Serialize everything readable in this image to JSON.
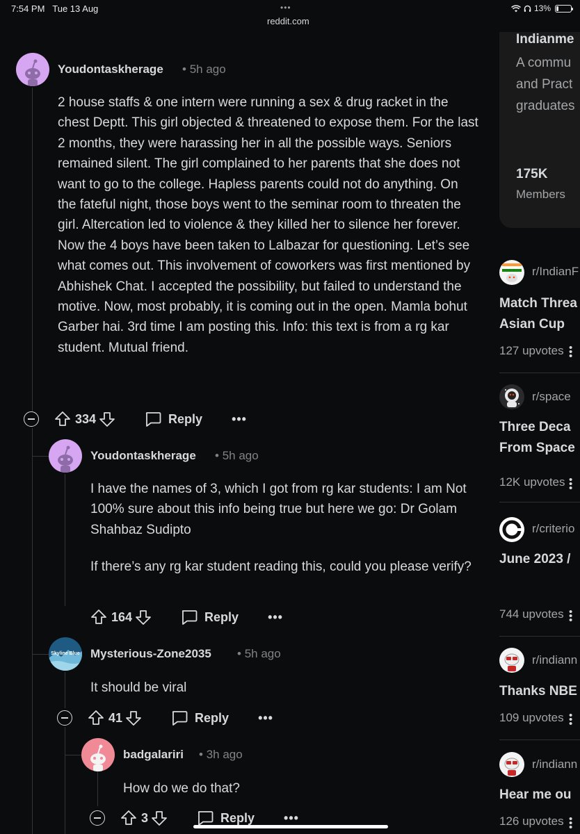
{
  "status_bar": {
    "time": "7:54 PM",
    "date": "Tue 13 Aug",
    "url": "reddit.com",
    "battery": "13%",
    "battery_level": 0.13
  },
  "comments": [
    {
      "author": "Youdontaskherage",
      "time": "5h ago",
      "body": "2 house staffs & one intern were running a sex & drug racket in the chest Deptt. This girl objected & threatened to expose them. For the last 2 months, they were harassing her in all the possible ways. Seniors remained silent. The girl complained to her parents that she does not want to go to the college. Hapless parents could not do anything. On the fateful night, those boys went to the seminar room to threaten the girl. Altercation led to violence & they killed her to silence her forever. Now the 4 boys have been taken to Lalbazar for questioning. Let’s see what comes out. This involvement of coworkers was first mentioned by Abhishek Chat. I accepted the possibility, but failed to understand the motive. Now, most probably, it is coming out in the open. Mamla bohut Garber hai. 3rd time I am posting this. Info: this text is from a rg kar student. Mutual friend.",
      "votes": "334",
      "reply_label": "Reply",
      "more_label": "•••"
    },
    {
      "author": "Youdontaskherage",
      "time": "5h ago",
      "body_p1": "I have the names of 3, which I got from rg kar students: I am Not 100% sure about this info being true but here we go: Dr Golam Shahbaz Sudipto",
      "body_p2": "If there’s any rg kar student reading this, could you please verify?",
      "votes": "164",
      "reply_label": "Reply",
      "more_label": "•••"
    },
    {
      "author": "Mysterious-Zone2035",
      "time": "5h ago",
      "avatar_text": "Skyline Blue",
      "body": "It should be viral",
      "votes": "41",
      "reply_label": "Reply",
      "more_label": "•••"
    },
    {
      "author": "badgalariri",
      "time": "3h ago",
      "body": "How do we do that?",
      "votes": "3",
      "reply_label": "Reply",
      "more_label": "•••"
    }
  ],
  "sidebar": {
    "community": {
      "name": "Indianme",
      "description": "A commu and Pract graduates",
      "members_count": "175K",
      "members_label": "Members"
    },
    "posts": [
      {
        "subreddit": "r/IndianF",
        "title_line1": "Match Threa",
        "title_line2": "Asian Cup",
        "upvotes": "127 upvotes",
        "icon": "india-flag-snoo-icon"
      },
      {
        "subreddit": "r/space",
        "title_line1": "Three Deca",
        "title_line2": "From Space",
        "upvotes": "12K upvotes",
        "icon": "astronaut-snoo-icon"
      },
      {
        "subreddit": "r/criterio",
        "title_line1": "June 2023 /",
        "title_line2": "",
        "upvotes": "744 upvotes",
        "icon": "criterion-logo-icon"
      },
      {
        "subreddit": "r/indiann",
        "title_line1": "Thanks NBE",
        "title_line2": "",
        "upvotes": "109 upvotes",
        "icon": "snoo-glasses-icon"
      },
      {
        "subreddit": "r/indiann",
        "title_line1": "Hear me ou",
        "title_line2": "",
        "upvotes": "126 upvotes",
        "icon": "snoo-glasses-icon"
      }
    ],
    "more_label": "•••"
  }
}
